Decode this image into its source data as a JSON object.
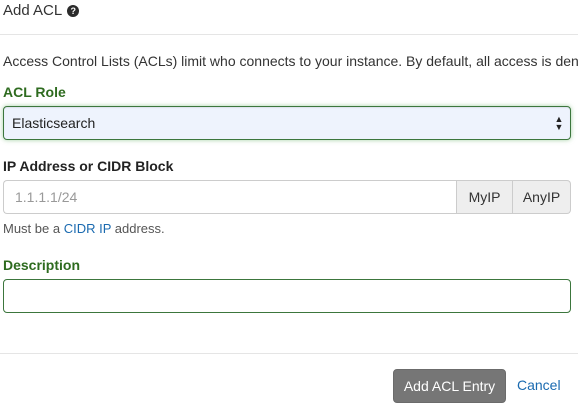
{
  "header": {
    "title": "Add ACL",
    "help_icon": "question-circle-icon"
  },
  "intro_text": "Access Control Lists (ACLs) limit who connects to your instance. By default, all access is denied.",
  "acl_role": {
    "label": "ACL Role",
    "selected": "Elasticsearch"
  },
  "ip": {
    "label": "IP Address or CIDR Block",
    "placeholder": "1.1.1.1/24",
    "value": "",
    "myip_label": "MyIP",
    "anyip_label": "AnyIP",
    "help_prefix": "Must be a ",
    "help_link": "CIDR IP",
    "help_suffix": " address."
  },
  "description": {
    "label": "Description",
    "value": ""
  },
  "footer": {
    "submit_label": "Add ACL Entry",
    "cancel_label": "Cancel"
  },
  "colors": {
    "success_green": "#3c763d",
    "link_blue": "#1a6ab0",
    "button_gray": "#767676"
  }
}
